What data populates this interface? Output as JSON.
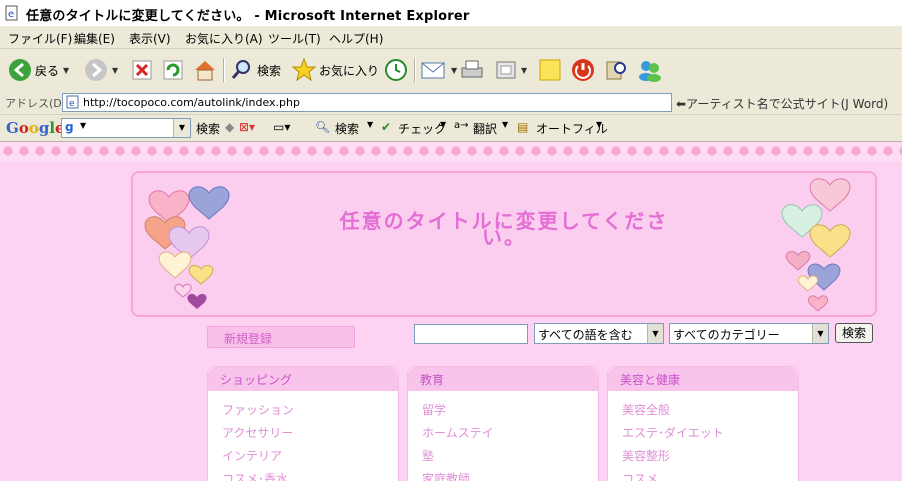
{
  "window": {
    "title": "任意のタイトルに変更してください。 - Microsoft Internet Explorer"
  },
  "menu": [
    "ファイル(F)",
    "編集(E)",
    "表示(V)",
    "お気に入り(A)",
    "ツール(T)",
    "ヘルプ(H)"
  ],
  "toolbar": {
    "back": "戻る",
    "search": "検索",
    "favorites": "お気に入り"
  },
  "address": {
    "label": "アドレス(D)",
    "url": "http://tocopoco.com/autolink/index.php",
    "links_text": "⬅アーティスト名で公式サイト(J Word)"
  },
  "google_bar": {
    "logo": "Google",
    "g": "g",
    "search": "検索",
    "search2": "検索",
    "check": "チェック",
    "translate": "翻訳",
    "autofill": "オートフィル"
  },
  "page": {
    "site_title": "任意のタイトルに変更してください。",
    "register": "新規登録",
    "search_input": "",
    "match_select": "すべての語を含む",
    "category_select": "すべてのカテゴリー",
    "search_button": "検索",
    "categories": [
      {
        "title": "ショッピング",
        "items": [
          "ファッション",
          "アクセサリー",
          "インテリア",
          "コスメ･香水"
        ]
      },
      {
        "title": "教育",
        "items": [
          "留学",
          "ホームステイ",
          "塾",
          "家庭教師"
        ]
      },
      {
        "title": "美容と健康",
        "items": [
          "美容全般",
          "エステ･ダイエット",
          "美容整形",
          "コスメ"
        ]
      }
    ]
  }
}
